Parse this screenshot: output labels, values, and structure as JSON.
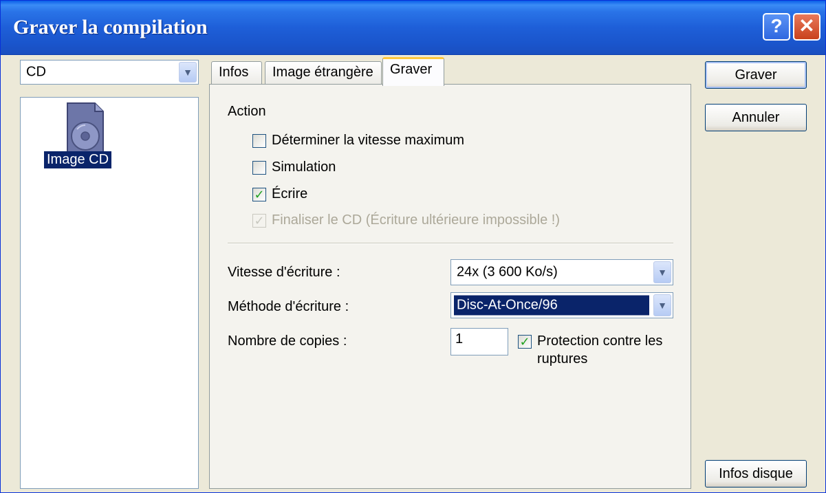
{
  "window": {
    "title": "Graver la compilation",
    "help_label": "?",
    "close_label": "✕"
  },
  "drive_select": {
    "value": "CD"
  },
  "compilation_list": {
    "items": [
      {
        "label": "Image CD",
        "icon": "cd-image-icon"
      }
    ]
  },
  "tabs": [
    {
      "label": "Infos",
      "active": false
    },
    {
      "label": "Image étrangère",
      "active": false
    },
    {
      "label": "Graver",
      "active": true
    }
  ],
  "burn_tab": {
    "action_title": "Action",
    "checkboxes": [
      {
        "label": "Déterminer la vitesse maximum",
        "checked": false,
        "enabled": true
      },
      {
        "label": "Simulation",
        "checked": false,
        "enabled": true
      },
      {
        "label": "Écrire",
        "checked": true,
        "enabled": true
      },
      {
        "label": "Finaliser le CD (Écriture ultérieure impossible !)",
        "checked": true,
        "enabled": false
      }
    ],
    "write_speed_label": "Vitesse d'écriture :",
    "write_speed_value": "24x (3 600 Ko/s)",
    "write_method_label": "Méthode d'écriture :",
    "write_method_value": "Disc-At-Once/96",
    "copies_label": "Nombre de copies :",
    "copies_value": "1",
    "buffer_protection_label_1": "Protection contre les",
    "buffer_protection_label_2": "ruptures",
    "buffer_protection_checked": true
  },
  "buttons": {
    "burn": "Graver",
    "cancel": "Annuler",
    "disc_info": "Infos disque"
  },
  "colors": {
    "titlebar": "#1e5fd8",
    "selection": "#0a246a",
    "check": "#21a121",
    "active_tab_accent": "#ffc83c"
  }
}
